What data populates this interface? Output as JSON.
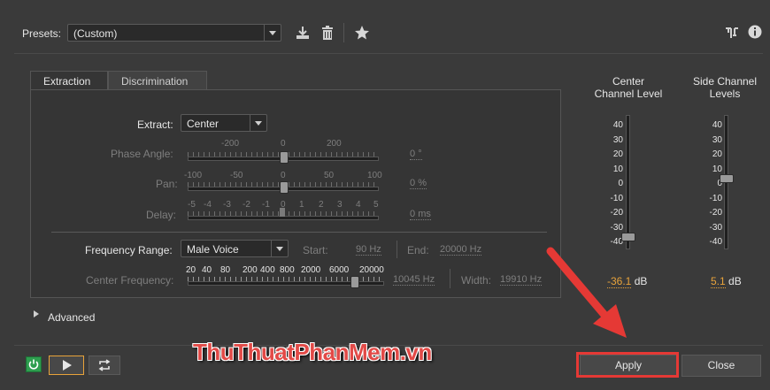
{
  "presets": {
    "label": "Presets:",
    "value": "(Custom)"
  },
  "tabs": [
    {
      "label": "Extraction",
      "active": true
    },
    {
      "label": "Discrimination",
      "active": false
    }
  ],
  "extract": {
    "label": "Extract:",
    "value": "Center"
  },
  "phase_angle": {
    "label": "Phase Angle:",
    "ticks": [
      "-200",
      "0",
      "200"
    ],
    "value": "0",
    "unit": "°"
  },
  "pan": {
    "label": "Pan:",
    "ticks": [
      "-100",
      "-50",
      "0",
      "50",
      "100"
    ],
    "value": "0",
    "unit": "%"
  },
  "delay": {
    "label": "Delay:",
    "ticks": [
      "-5",
      "-4",
      "-3",
      "-2",
      "-1",
      "0",
      "1",
      "2",
      "3",
      "4",
      "5"
    ],
    "value": "0",
    "unit": "ms"
  },
  "frequency_range": {
    "label": "Frequency Range:",
    "value": "Male Voice",
    "start_label": "Start:",
    "start_value": "90",
    "start_unit": "Hz",
    "end_label": "End:",
    "end_value": "20000",
    "end_unit": "Hz"
  },
  "center_frequency": {
    "label": "Center Frequency:",
    "ticks": [
      "20",
      "40",
      "80",
      "200",
      "400",
      "800",
      "2000",
      "6000",
      "20000"
    ],
    "value": "10045",
    "unit": "Hz",
    "width_label": "Width:",
    "width_value": "19910",
    "width_unit": "Hz"
  },
  "center_channel": {
    "title_line1": "Center",
    "title_line2": "Channel Level",
    "value": "-36.1",
    "unit": "dB"
  },
  "side_channel": {
    "title_line1": "Side Channel",
    "title_line2": "Levels",
    "value": "5.1",
    "unit": "dB"
  },
  "meter_scale": [
    "40",
    "30",
    "20",
    "10",
    "0",
    "-10",
    "-20",
    "-30",
    "-40"
  ],
  "advanced_label": "Advanced",
  "watermark": "ThuThuatPhanMem.vn",
  "apply_label": "Apply",
  "close_label": "Close",
  "colors": {
    "accent_value": "#e8a33a",
    "highlight_red": "#e53935",
    "power_green": "#2e9e4f"
  }
}
